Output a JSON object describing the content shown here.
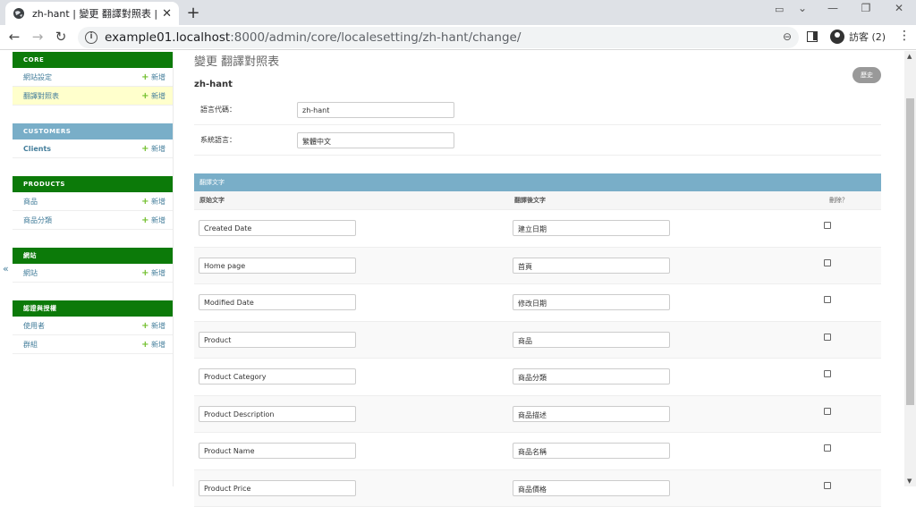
{
  "browser": {
    "tab_title": "zh-hant | 變更 翻譯對照表 | Djar",
    "url_host": "example01.localhost",
    "url_path": ":8000/admin/core/localesetting/zh-hant/change/",
    "profile_label": "訪客 (2)"
  },
  "sidebar": {
    "modules": [
      {
        "title": "CORE",
        "color": "green",
        "items": [
          {
            "label": "網站設定",
            "add": "新增",
            "selected": false,
            "bold": false
          },
          {
            "label": "翻譯對照表",
            "add": "新增",
            "selected": true,
            "bold": false
          }
        ]
      },
      {
        "title": "CUSTOMERS",
        "color": "blue",
        "items": [
          {
            "label": "Clients",
            "add": "新增",
            "selected": false,
            "bold": true
          }
        ]
      },
      {
        "title": "PRODUCTS",
        "color": "green",
        "items": [
          {
            "label": "商品",
            "add": "新增",
            "selected": false,
            "bold": false
          },
          {
            "label": "商品分類",
            "add": "新增",
            "selected": false,
            "bold": false
          }
        ]
      },
      {
        "title": "網站",
        "color": "green",
        "items": [
          {
            "label": "網站",
            "add": "新增",
            "selected": false,
            "bold": false
          }
        ]
      },
      {
        "title": "認證與授權",
        "color": "green",
        "items": [
          {
            "label": "使用者",
            "add": "新增",
            "selected": false,
            "bold": false
          },
          {
            "label": "群組",
            "add": "新增",
            "selected": false,
            "bold": false
          }
        ]
      }
    ],
    "collapse_glyph": "«"
  },
  "main": {
    "page_heading": "變更 翻譯對照表",
    "object_title": "zh-hant",
    "history_button": "歷史",
    "fields": [
      {
        "label": "語言代碼：",
        "value": "zh-hant"
      },
      {
        "label": "系統語言：",
        "value": "繁體中文"
      }
    ],
    "inline": {
      "heading": "翻譯文字",
      "col_source": "原始文字",
      "col_translated": "翻譯後文字",
      "col_delete": "刪除？",
      "rows": [
        {
          "source": "Created Date",
          "translated": "建立日期"
        },
        {
          "source": "Home page",
          "translated": "首頁"
        },
        {
          "source": "Modified Date",
          "translated": "修改日期"
        },
        {
          "source": "Product",
          "translated": "商品"
        },
        {
          "source": "Product Category",
          "translated": "商品分類"
        },
        {
          "source": "Product Description",
          "translated": "商品描述"
        },
        {
          "source": "Product Name",
          "translated": "商品名稱"
        },
        {
          "source": "Product Price",
          "translated": "商品價格"
        }
      ]
    }
  }
}
